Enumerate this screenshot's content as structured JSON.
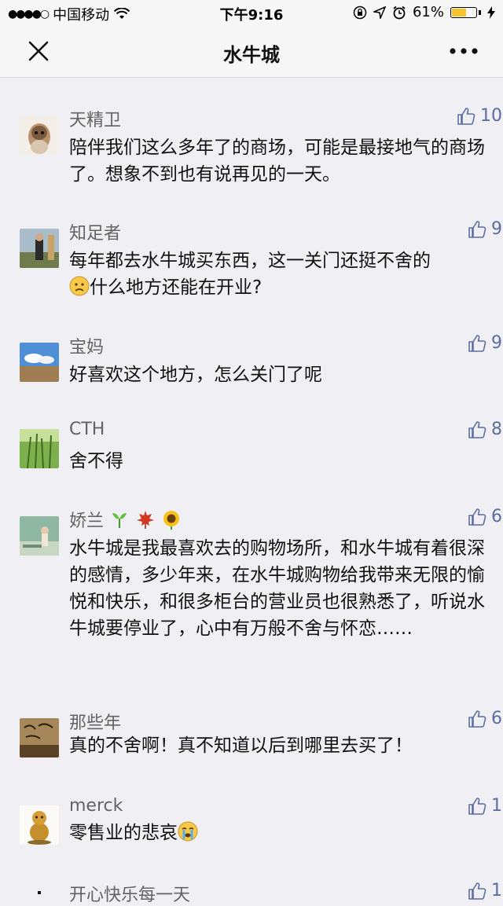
{
  "status_bar": {
    "carrier": "中国移动",
    "time": "下午9:16",
    "battery": "61%",
    "battery_level": 0.61
  },
  "nav": {
    "title": "水牛城"
  },
  "comments": [
    {
      "name": "天精卫",
      "likes": "10",
      "text": "陪伴我们这么多年了的商场，可能是最接地气的商场了。想象不到也有说再见的一天。"
    },
    {
      "name": "知足者",
      "likes": "9",
      "text": "每年都去水牛城买东西，这一关门还挺不舍的",
      "text2": "什么地方还能在开业?",
      "emoji": "sad-face-icon"
    },
    {
      "name": "宝妈",
      "likes": "9",
      "text": "好喜欢这个地方，怎么关门了呢"
    },
    {
      "name": "CTH",
      "likes": "8",
      "text": "舍不得"
    },
    {
      "name": "娇兰",
      "likes": "6",
      "text": "水牛城是我最喜欢去的购物场所，和水牛城有着很深的感情，多少年来，在水牛城购物给我带来无限的愉悦和快乐，和很多柜台的营业员也很熟悉了，听说水牛城要停业了，心中有万般不舍与怀恋……",
      "name_emojis": [
        "sprout-icon",
        "maple-leaf-icon",
        "sunflower-icon"
      ]
    },
    {
      "name": "那些年",
      "likes": "6",
      "text": "真的不舍啊！真不知道以后到哪里去买了！"
    },
    {
      "name": "merck",
      "likes": "1",
      "text": "零售业的悲哀",
      "emoji": "crying-face-icon"
    },
    {
      "name": "开心快乐每一天",
      "likes": "1",
      "text": ""
    }
  ],
  "colors": {
    "background": "#efeff4",
    "bar": "#f7f7f7",
    "name": "#636363",
    "like": "#5c6ea0"
  }
}
